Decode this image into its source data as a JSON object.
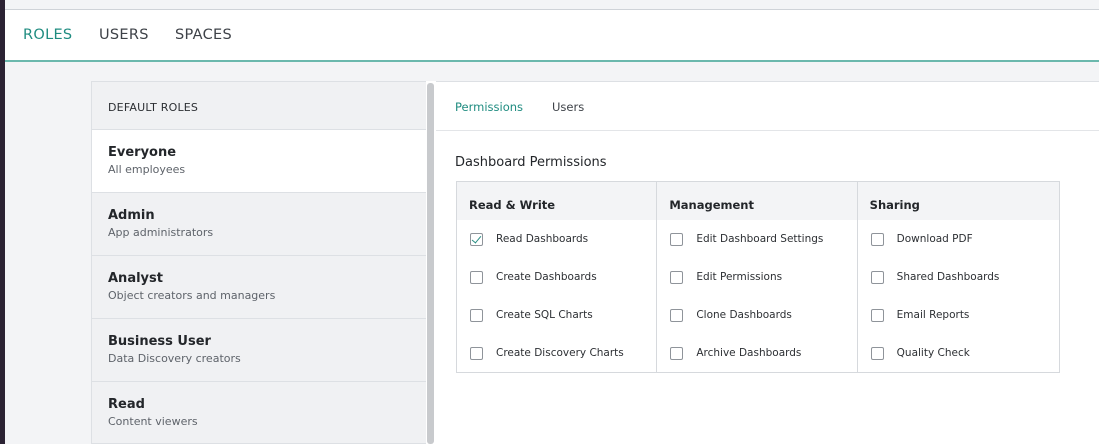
{
  "header": {
    "tabs": [
      {
        "label": "ROLES",
        "active": true
      },
      {
        "label": "USERS",
        "active": false
      },
      {
        "label": "SPACES",
        "active": false
      }
    ]
  },
  "sidebar": {
    "title": "DEFAULT ROLES",
    "roles": [
      {
        "name": "Everyone",
        "description": "All employees",
        "selected": true
      },
      {
        "name": "Admin",
        "description": "App administrators",
        "selected": false
      },
      {
        "name": "Analyst",
        "description": "Object creators and managers",
        "selected": false
      },
      {
        "name": "Business User",
        "description": "Data Discovery creators",
        "selected": false
      },
      {
        "name": "Read",
        "description": "Content viewers",
        "selected": false
      }
    ]
  },
  "main": {
    "tabs": [
      {
        "label": "Permissions",
        "active": true
      },
      {
        "label": "Users",
        "active": false
      }
    ],
    "section_title": "Dashboard Permissions",
    "columns": [
      {
        "heading": "Read & Write",
        "items": [
          {
            "label": "Read Dashboards",
            "checked": true
          },
          {
            "label": "Create Dashboards",
            "checked": false
          },
          {
            "label": "Create SQL Charts",
            "checked": false
          },
          {
            "label": "Create Discovery Charts",
            "checked": false
          }
        ]
      },
      {
        "heading": "Management",
        "items": [
          {
            "label": "Edit Dashboard Settings",
            "checked": false
          },
          {
            "label": "Edit Permissions",
            "checked": false
          },
          {
            "label": "Clone Dashboards",
            "checked": false
          },
          {
            "label": "Archive Dashboards",
            "checked": false
          }
        ]
      },
      {
        "heading": "Sharing",
        "items": [
          {
            "label": "Download PDF",
            "checked": false
          },
          {
            "label": "Shared Dashboards",
            "checked": false
          },
          {
            "label": "Email Reports",
            "checked": false
          },
          {
            "label": "Quality Check",
            "checked": false
          }
        ]
      }
    ]
  },
  "colors": {
    "accent": "#1f8c80",
    "accent_underline": "#6bb8ad"
  }
}
